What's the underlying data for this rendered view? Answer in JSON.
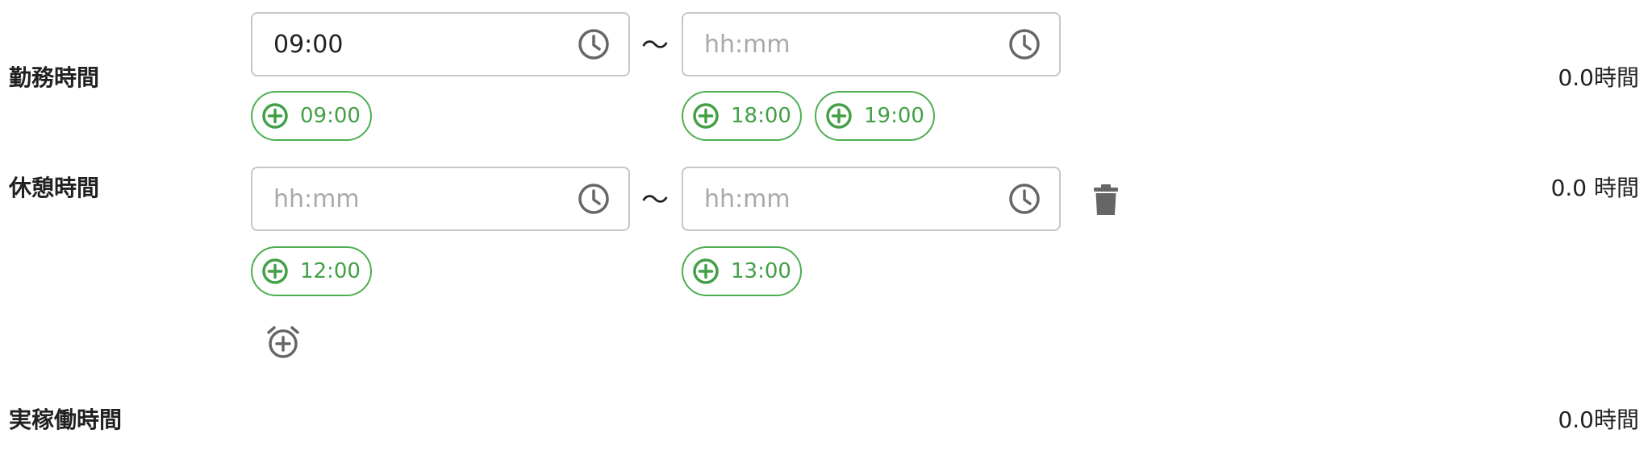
{
  "work_time": {
    "label": "勤務時間",
    "start_value": "09:00",
    "start_placeholder": "hh:mm",
    "end_value": "",
    "end_placeholder": "hh:mm",
    "separator": "〜",
    "start_chips": [
      "09:00"
    ],
    "end_chips": [
      "18:00",
      "19:00"
    ],
    "total": "0.0時間"
  },
  "break_time": {
    "label": "休憩時間",
    "start_value": "",
    "start_placeholder": "hh:mm",
    "end_value": "",
    "end_placeholder": "hh:mm",
    "separator": "〜",
    "start_chips": [
      "12:00"
    ],
    "end_chips": [
      "13:00"
    ],
    "total": "0.0 時間"
  },
  "actual_work_time": {
    "label": "実稼働時間",
    "total": "0.0時間"
  },
  "icons": {
    "clock": "clock-icon",
    "chip_add": "add-circle-icon",
    "delete": "trash-icon",
    "add_break": "alarm-add-icon"
  },
  "colors": {
    "accent_green": "#43a047",
    "icon_gray": "#666666",
    "border_gray": "#c7c7c7",
    "placeholder_gray": "#a9a9a9"
  }
}
